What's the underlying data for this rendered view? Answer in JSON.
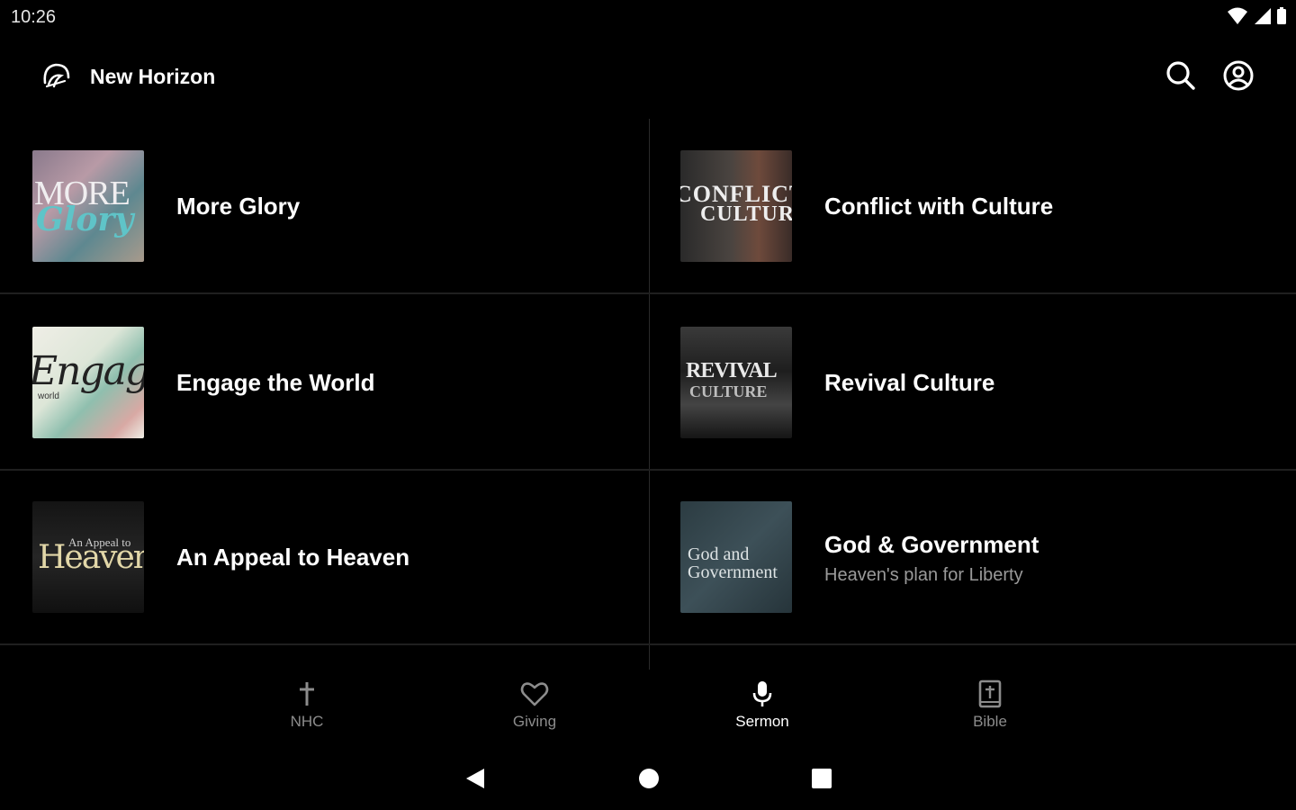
{
  "status": {
    "time": "10:26"
  },
  "app_bar": {
    "title": "New Horizon",
    "search_icon": "search-icon",
    "account_icon": "account-circle-icon"
  },
  "sermons": [
    {
      "title": "More Glory",
      "subtitle": "",
      "thumb_text_top": "MORE",
      "thumb_text_bottom": "Glory"
    },
    {
      "title": "Conflict with Culture",
      "subtitle": "",
      "thumb_text_top": "CONFLICT",
      "thumb_text_bottom": "CULTURE"
    },
    {
      "title": "Engage the World",
      "subtitle": "",
      "thumb_text_top": "Engage",
      "thumb_text_bottom": "world"
    },
    {
      "title": "Revival Culture",
      "subtitle": "",
      "thumb_text_top": "REVIVAL",
      "thumb_text_bottom": "CULTURE"
    },
    {
      "title": "An Appeal to Heaven",
      "subtitle": "",
      "thumb_text_top": "An Appeal to",
      "thumb_text_bottom": "Heaven"
    },
    {
      "title": "God & Government",
      "subtitle": "Heaven's plan for Liberty",
      "thumb_text_top": "God and",
      "thumb_text_bottom": "Government"
    }
  ],
  "bottom_nav": [
    {
      "label": "NHC",
      "icon": "cross-icon",
      "active": false
    },
    {
      "label": "Giving",
      "icon": "heart-icon",
      "active": false
    },
    {
      "label": "Sermon",
      "icon": "microphone-icon",
      "active": true
    },
    {
      "label": "Bible",
      "icon": "bible-icon",
      "active": false
    }
  ],
  "colors": {
    "background": "#000000",
    "text": "#ffffff",
    "muted": "#9a9a9a",
    "divider": "#2a2a2a"
  }
}
